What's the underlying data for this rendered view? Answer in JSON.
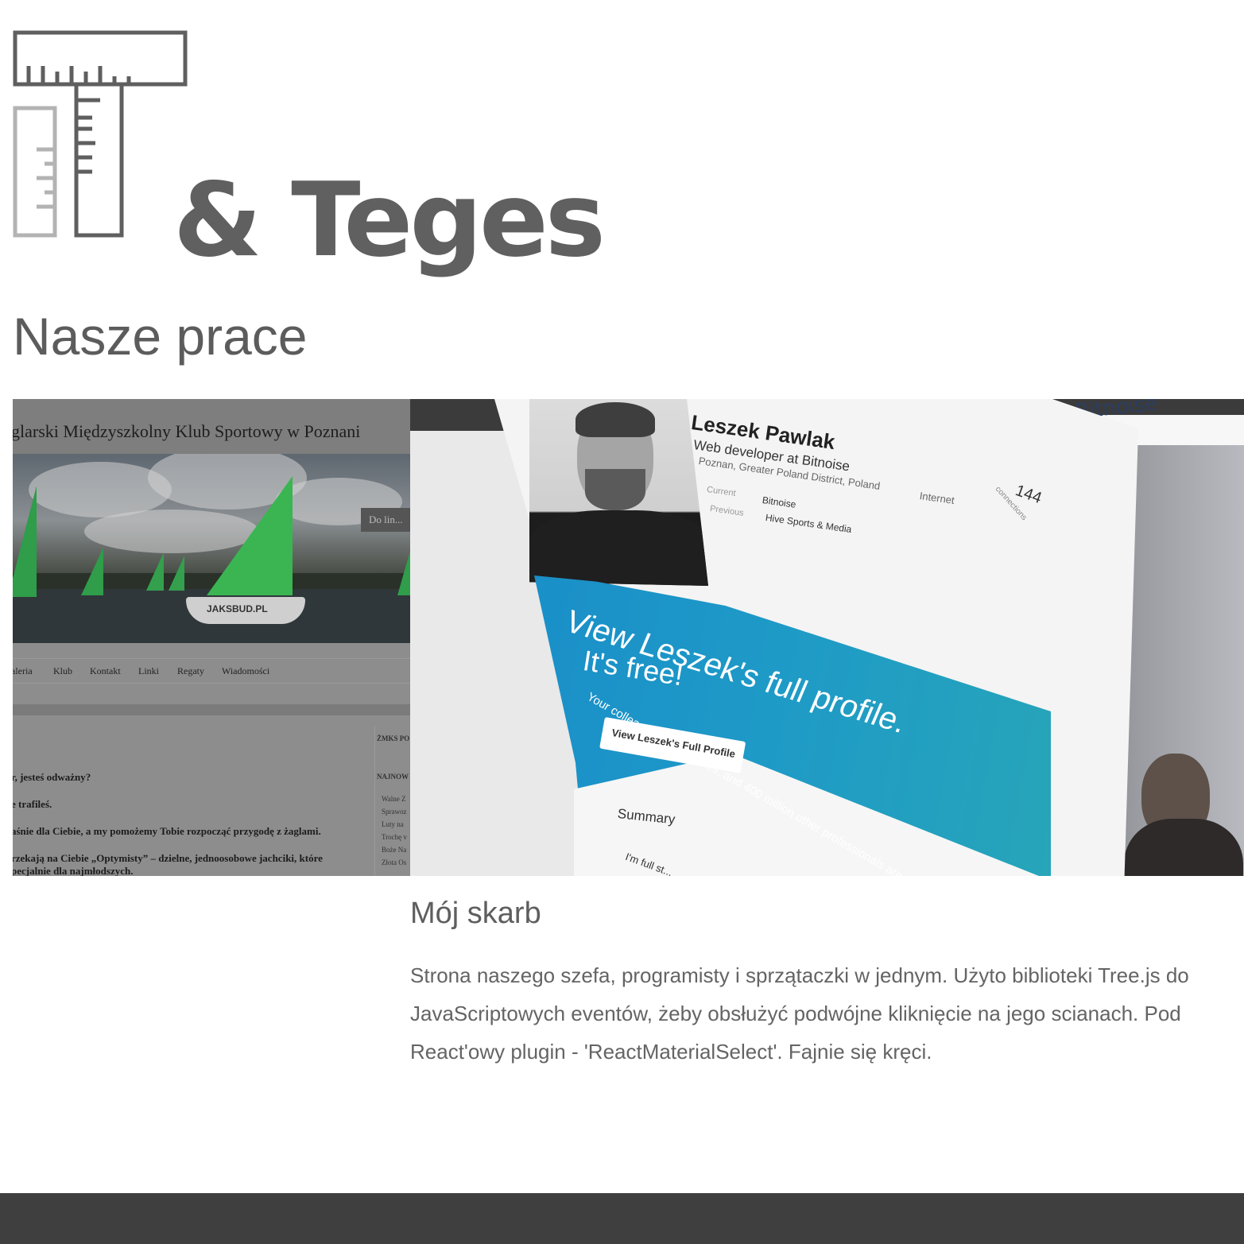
{
  "brand": {
    "name": "& Teges",
    "logo_icon": "ruler-t-square-icon"
  },
  "section": {
    "title": "Nasze prace"
  },
  "slides": [
    {
      "type": "screenshot",
      "header": "glarski Międzyszkolny Klub Sportowy w Poznani",
      "badge": "Do lin...",
      "hull_text": "JAKSBUD.PL",
      "nav": [
        "aleria",
        "Klub",
        "Kontakt",
        "Linki",
        "Regaty",
        "Wiadomości"
      ],
      "body_lines": [
        "r, jesteś odważny?",
        "e trafileś.",
        "aśnie dla Ciebie, a my pomożemy Tobie rozpocząć przygodę z żaglami.",
        "rzekają na Ciebie „Optymisty” – dzielne, jednoosobowe jachciki, które",
        "pecjalnie dla najmłodszych."
      ],
      "sidebar_heading_1": "ŻMKS PO",
      "sidebar_heading_2": "NAJNOW",
      "sidebar_links": [
        "Walne Z",
        "Sprawoz",
        "Luty na",
        "Trochę v",
        "Boże Na",
        "Złota Os"
      ]
    },
    {
      "type": "cube",
      "logo": "Bitnoise",
      "name": "Leszek Pawlak",
      "headline": "Web developer at Bitnoise",
      "location": "Poznan, Greater Poland District, Poland",
      "industry": "Internet",
      "current_label": "Current",
      "current_value": "Bitnoise",
      "previous_label": "Previous",
      "previous_value": "Hive Sports & Media",
      "connections_count": "144",
      "connections_label": "connections",
      "banner_line1": "View Leszek's full profile.",
      "banner_line2": "It's free!",
      "banner_sub": "Your colleagues, classmates, and 400 million other professionals are on Linke",
      "cta": "View Leszek's Full Profile",
      "summary_label": "Summary",
      "summary_text": "I'm full st..."
    }
  ],
  "caption": {
    "title": "Mój skarb",
    "lines": [
      "Strona naszego szefa, programisty i sprzątaczki w jednym. Użyto biblioteki Tree.js do",
      "JavaScriptowych eventów, żeby obsłużyć podwójne kliknięcie na jego scianach. Pod",
      "React'owy plugin - 'ReactMaterialSelect'. Fajnie się kręci."
    ]
  },
  "colors": {
    "text": "#5f5f5f",
    "footer": "#3f3f3f",
    "banner": "#1e9ac7"
  }
}
